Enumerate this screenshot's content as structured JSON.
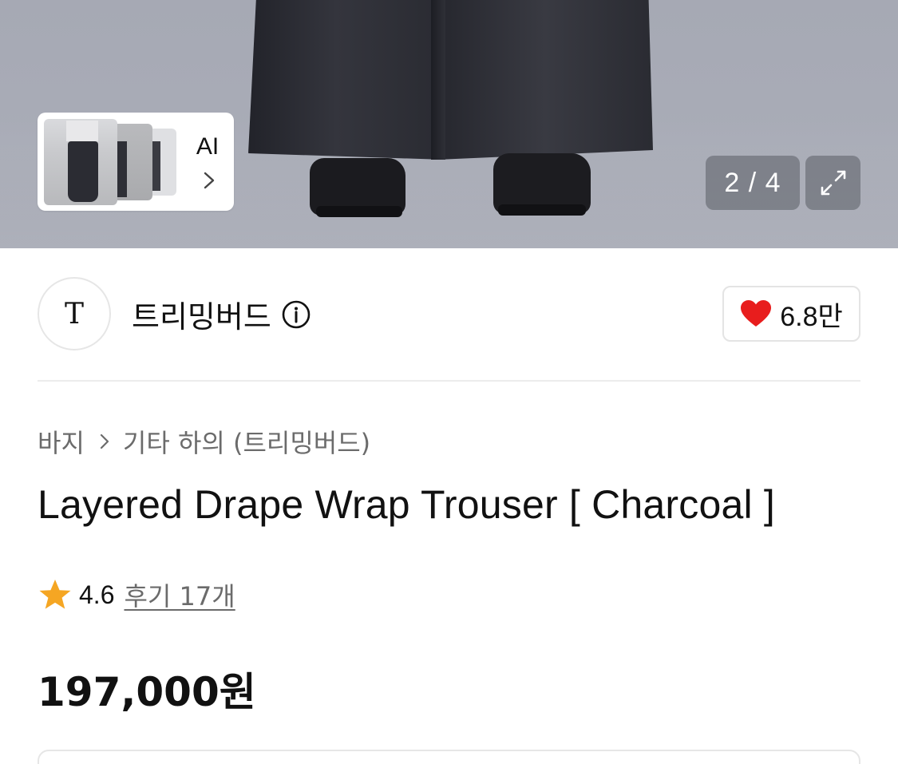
{
  "gallery": {
    "current": 2,
    "total": 4,
    "counter_text": "2 / 4",
    "ai_label": "AI",
    "icons": {
      "ai_more": "chevron-right-icon",
      "expand": "expand-arrows-icon"
    }
  },
  "brand": {
    "logo_text": "T",
    "name": "트리밍버드",
    "info_icon": "info-circle-icon",
    "like_icon": "heart-icon",
    "like_count": "6.8만",
    "like_color": "#e81d1d"
  },
  "product": {
    "breadcrumb": [
      "바지",
      "기타 하의 (트리밍버드)"
    ],
    "breadcrumb_icon": "chevron-right-icon",
    "title": "Layered Drape Wrap Trouser [ Charcoal ]",
    "rating": "4.6",
    "rating_icon": "star-icon",
    "rating_color": "#f5a623",
    "review_link": "후기 17개",
    "price": "197,000원"
  }
}
